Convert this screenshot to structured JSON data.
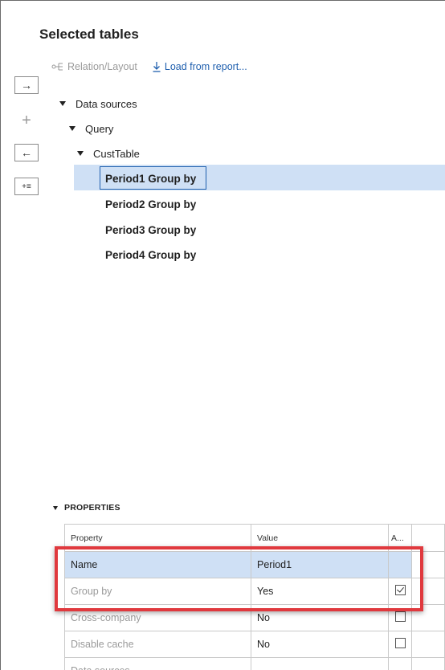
{
  "panel": {
    "title": "Selected tables"
  },
  "toolbar": {
    "relation_layout": "Relation/Layout",
    "load_from_report": "Load from report..."
  },
  "side_buttons": {
    "add_arrow": "→",
    "plus": "+",
    "remove_arrow": "←",
    "add_list": "+≡"
  },
  "tree": {
    "data_sources": "Data sources",
    "query": "Query",
    "cust_table": "CustTable",
    "leaves": [
      "Period1 Group by",
      "Period2 Group by",
      "Period3 Group by",
      "Period4 Group by"
    ],
    "selected_index": 0
  },
  "properties": {
    "header": "PROPERTIES",
    "columns": [
      "Property",
      "Value",
      "A..."
    ],
    "rows": [
      {
        "property": "Name",
        "value": "Period1",
        "checked": null,
        "selected": true,
        "dim": false
      },
      {
        "property": "Group by",
        "value": "Yes",
        "checked": true,
        "selected": false,
        "dim": true
      },
      {
        "property": "Cross-company",
        "value": "No",
        "checked": false,
        "selected": false,
        "dim": true
      },
      {
        "property": "Disable cache",
        "value": "No",
        "checked": false,
        "selected": false,
        "dim": true
      },
      {
        "property": "Data sources",
        "value": "",
        "checked": null,
        "selected": false,
        "dim": true
      }
    ]
  },
  "annotation": {
    "color": "#e0393e"
  }
}
